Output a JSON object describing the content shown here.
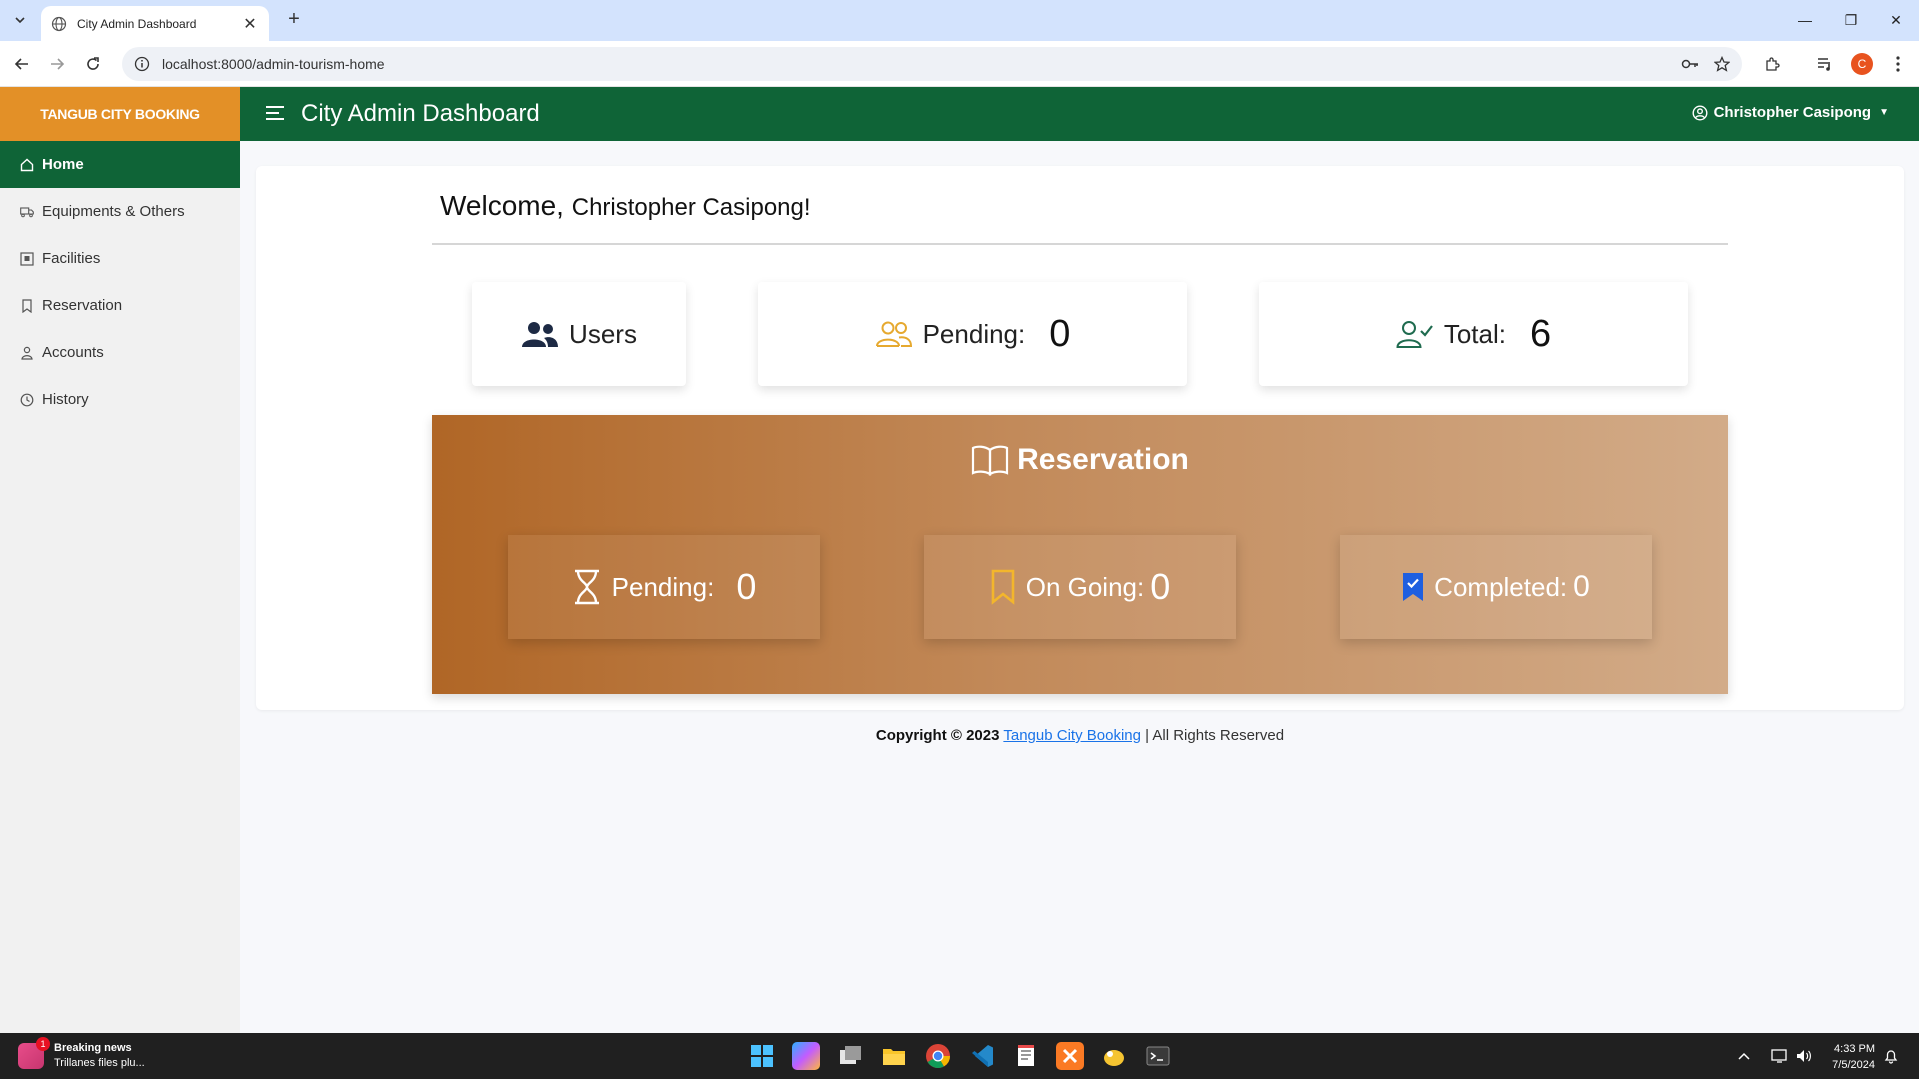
{
  "browser": {
    "tab_title": "City Admin Dashboard",
    "url": "localhost:8000/admin-tourism-home",
    "profile_initial": "C"
  },
  "app": {
    "brand": "TANGUB CITY BOOKING",
    "page_title": "City Admin Dashboard",
    "user_name": "Christopher Casipong",
    "accent_green": "#0f6437",
    "accent_orange": "#e39027"
  },
  "sidebar": {
    "items": [
      {
        "label": "Home",
        "icon": "home-icon"
      },
      {
        "label": "Equipments & Others",
        "icon": "truck-icon"
      },
      {
        "label": "Facilities",
        "icon": "building-icon"
      },
      {
        "label": "Reservation",
        "icon": "bookmark-icon"
      },
      {
        "label": "Accounts",
        "icon": "person-icon"
      },
      {
        "label": "History",
        "icon": "clock-icon"
      }
    ]
  },
  "welcome": {
    "prefix": "Welcome,",
    "name": "Christopher Casipong!"
  },
  "users_stats": {
    "users_label": "Users",
    "pending_label": "Pending:",
    "pending_value": "0",
    "total_label": "Total:",
    "total_value": "6"
  },
  "reservation": {
    "title": "Reservation",
    "pending_label": "Pending:",
    "pending_value": "0",
    "ongoing_label": "On Going:",
    "ongoing_value": "0",
    "completed_label": "Completed:",
    "completed_value": "0"
  },
  "footer": {
    "copyright": "Copyright © 2023",
    "link": "Tangub City Booking",
    "rights": "| All Rights Reserved"
  },
  "taskbar": {
    "news_title": "Breaking news",
    "news_subtitle": "Trillanes files plu...",
    "news_badge": "1",
    "time": "4:33 PM",
    "date": "7/5/2024"
  }
}
